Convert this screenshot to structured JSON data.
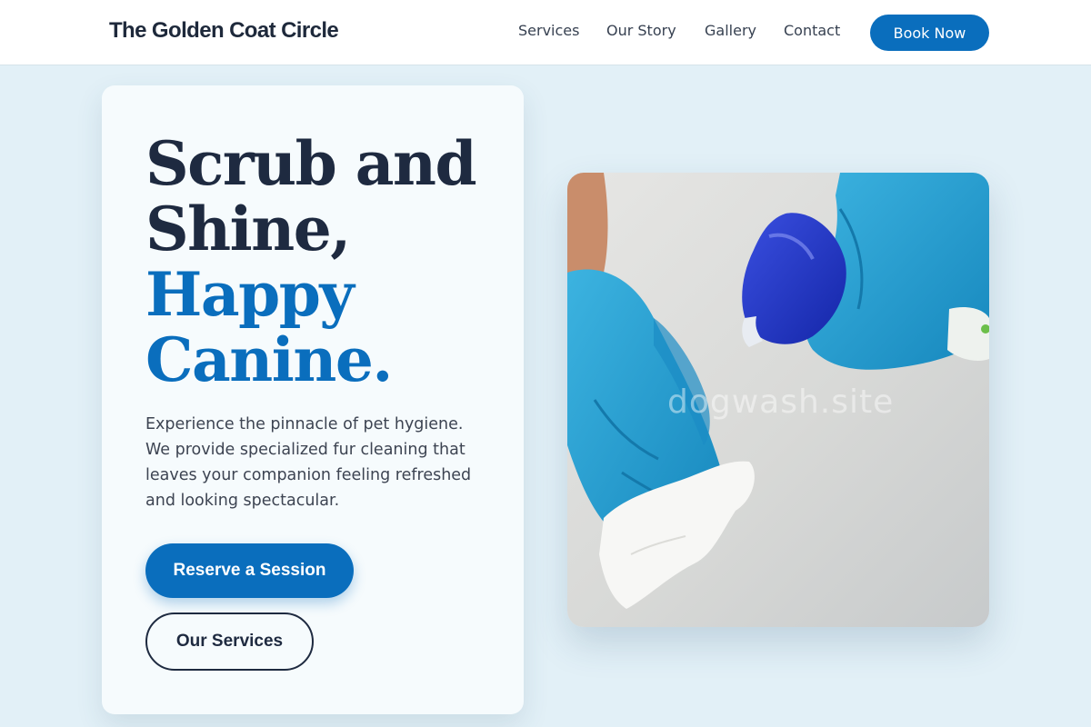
{
  "header": {
    "brand": "The Golden Coat Circle",
    "nav": {
      "services": "Services",
      "story": "Our Story",
      "gallery": "Gallery",
      "contact": "Contact"
    },
    "book_label": "Book Now"
  },
  "hero": {
    "headline_lines": [
      "Scrub and",
      "Shine,"
    ],
    "headline_accent_lines": [
      "Happy",
      "Canine."
    ],
    "description": "Experience the pinnacle of pet hygiene. We provide specialized fur cleaning that leaves your companion feeling refreshed and looking spectacular.",
    "primary_button": "Reserve a Session",
    "secondary_button": "Our Services"
  },
  "photo": {
    "watermark": "dogwash.site",
    "subject": "gloved-hands-cleaning-icon"
  },
  "colors": {
    "accent": "#0a6ebd",
    "page_background": "#e2f0f7",
    "dark_text": "#1e2a40"
  }
}
